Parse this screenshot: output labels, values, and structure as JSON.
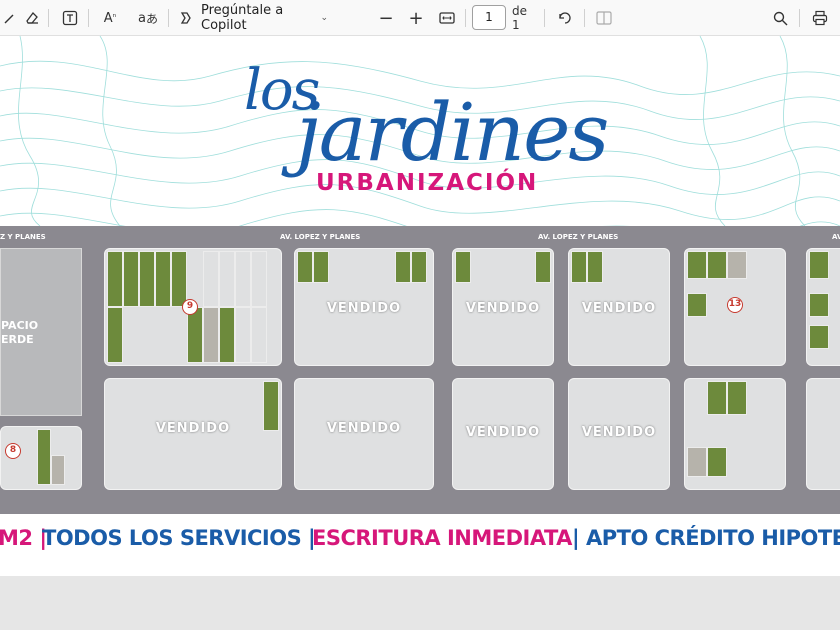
{
  "toolbar": {
    "copilot_label": "Pregúntale a Copilot",
    "page_number": "1",
    "page_total": "de 1",
    "tools": [
      "draw-icon",
      "eraser-icon",
      "text-icon",
      "read-aloud-icon",
      "translate-icon",
      "copilot-icon",
      "zoom-out-icon",
      "zoom-in-icon",
      "fit-page-icon",
      "rotate-icon",
      "two-page-icon",
      "search-icon",
      "print-icon"
    ]
  },
  "brochure": {
    "logo_los": "los",
    "logo_jardines": "jardines",
    "logo_urbanizacion": "URBANIZACIÓN",
    "street_1": "Z Y PLANES",
    "street_2": "AV. LOPEZ Y PLANES",
    "street_3": "AV. LOPEZ Y PLANES",
    "street_4": "AV.",
    "espacio_1": "PACIO",
    "espacio_2": "ERDE",
    "vendido": "VENDIDO",
    "markers": [
      "9",
      "13",
      "8"
    ],
    "tag_1": "M2 |",
    "tag_2": "TODOS LOS SERVICIOS |",
    "tag_3": "ESCRITURA INMEDIATA",
    "tag_4": "| APTO CRÉDITO HIPOTE",
    "colors": {
      "blue": "#1a5ca8",
      "magenta": "#d6177a",
      "teal_lines": "#7fd3cf"
    }
  }
}
